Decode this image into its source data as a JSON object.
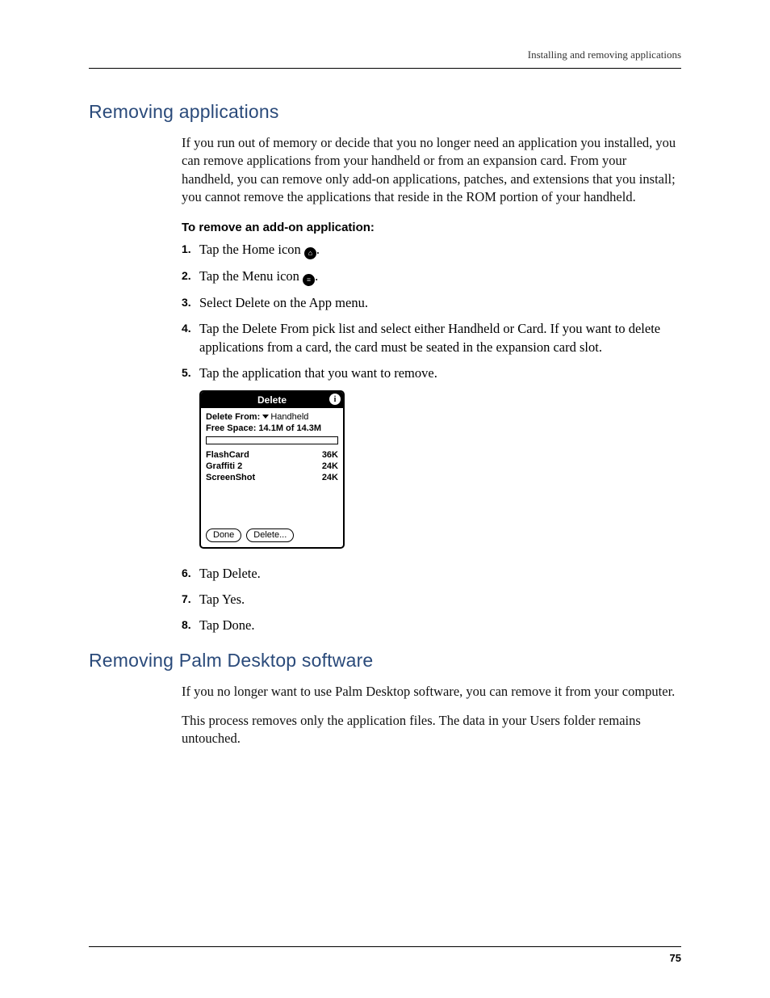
{
  "header": {
    "running": "Installing and removing applications"
  },
  "section1": {
    "heading": "Removing applications",
    "intro": "If you run out of memory or decide that you no longer need an application you installed, you can remove applications from your handheld or from an expansion card. From your handheld, you can remove only add-on applications, patches, and extensions that you install; you cannot remove the applications that reside in the ROM portion of your handheld.",
    "procTitle": "To remove an add-on application:",
    "steps": {
      "s1_a": "Tap the Home icon ",
      "s1_b": ".",
      "s2_a": "Tap the Menu icon ",
      "s2_b": ".",
      "s3": "Select Delete on the App menu.",
      "s4": "Tap the Delete From pick list and select either Handheld or Card. If you want to delete applications from a card, the card must be seated in the expansion card slot.",
      "s5": "Tap the application that you want to remove.",
      "s6": "Tap Delete.",
      "s7": "Tap Yes.",
      "s8": "Tap Done."
    }
  },
  "dialog": {
    "title": "Delete",
    "deleteFromLabel": "Delete From:",
    "deleteFromValue": "Handheld",
    "freeSpace": "Free Space: 14.1M of 14.3M",
    "items": [
      {
        "name": "FlashCard",
        "size": "36K"
      },
      {
        "name": "Graffiti 2",
        "size": "24K"
      },
      {
        "name": "ScreenShot",
        "size": "24K"
      }
    ],
    "btnDone": "Done",
    "btnDelete": "Delete..."
  },
  "section2": {
    "heading": "Removing Palm Desktop software",
    "p1": "If you no longer want to use Palm Desktop software, you can remove it from your computer.",
    "p2": "This process removes only the application files. The data in your Users folder remains untouched."
  },
  "pageNumber": "75",
  "stepNums": [
    "1.",
    "2.",
    "3.",
    "4.",
    "5.",
    "6.",
    "7.",
    "8."
  ]
}
